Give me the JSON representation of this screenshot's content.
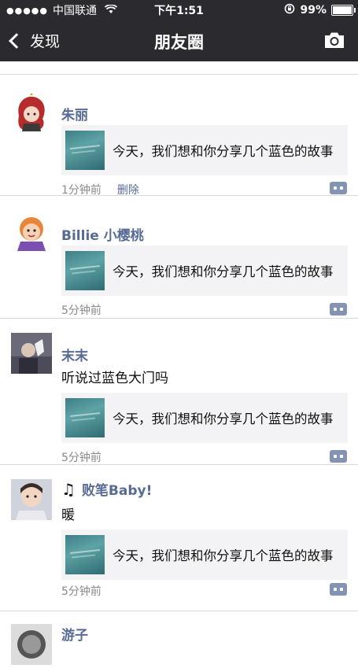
{
  "status": {
    "signal": "●●●●●",
    "carrier": "中国联通",
    "time": "下午1:51",
    "battery": "99%",
    "battery_level": 0.99
  },
  "nav": {
    "back_label": "发现",
    "title": "朋友圈"
  },
  "share_title": "今天，我们想和你分享几个蓝色的故事",
  "posts": [
    {
      "name": "朱丽",
      "time": "1分钟前",
      "delete_label": "删除"
    },
    {
      "name": "Billie 小樱桃",
      "time": "5分钟前"
    },
    {
      "name": "末末",
      "text": "听说过蓝色大门吗",
      "time": "5分钟前"
    },
    {
      "name": "败笔Baby!",
      "text": "暖",
      "time": "5分钟前"
    },
    {
      "name": "游子"
    }
  ],
  "colors": {
    "bar": "#2b2a2f",
    "name": "#576b95",
    "meta": "#8a8a8a"
  },
  "icons": {
    "back": "chevron-left-icon",
    "camera": "camera-icon",
    "comment": "comment-more-icon",
    "note": "music-note-icon"
  }
}
